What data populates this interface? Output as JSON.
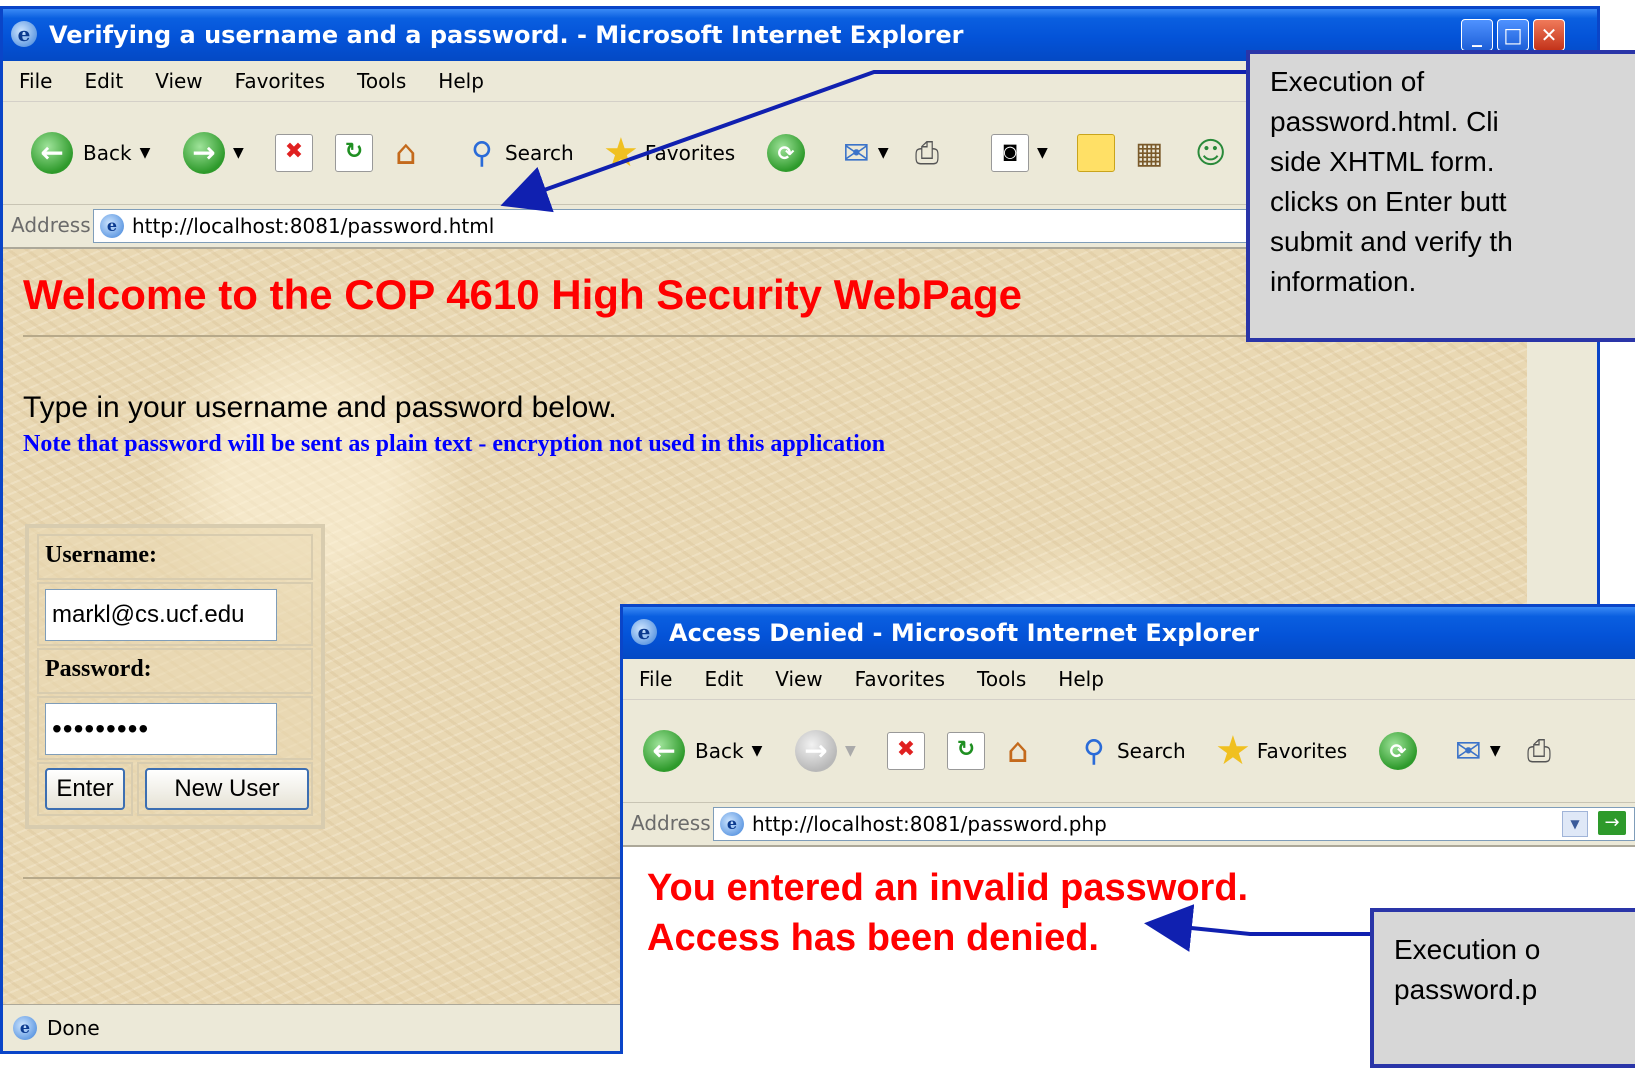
{
  "back_window": {
    "title": "Verifying a username and a password. - Microsoft Internet Explorer",
    "menu": [
      "File",
      "Edit",
      "View",
      "Favorites",
      "Tools",
      "Help"
    ],
    "toolbar": {
      "back_label": "Back",
      "search_label": "Search",
      "favorites_label": "Favorites"
    },
    "address_label": "Address",
    "url": "http://localhost:8081/password.html",
    "heading": "Welcome to the COP 4610 High Security WebPage",
    "prompt": "Type in your username and password below.",
    "note": "Note that password will be sent as plain text - encryption not used in this application",
    "form": {
      "username_label": "Username:",
      "username_value": "markl@cs.ucf.edu",
      "password_label": "Password:",
      "password_value": "•••••••••",
      "enter_label": "Enter",
      "new_user_label": "New User"
    },
    "status": "Done"
  },
  "front_window": {
    "title": "Access Denied - Microsoft Internet Explorer",
    "menu": [
      "File",
      "Edit",
      "View",
      "Favorites",
      "Tools",
      "Help"
    ],
    "toolbar": {
      "back_label": "Back",
      "search_label": "Search",
      "favorites_label": "Favorites"
    },
    "address_label": "Address",
    "url": "http://localhost:8081/password.php",
    "message_line1": "You entered an invalid password.",
    "message_line2": "Access has been denied."
  },
  "callout_top": {
    "lines": [
      "Execution of",
      "password.html.  Cli",
      "side XHTML form.",
      "clicks on Enter butt",
      "submit and verify th",
      "information."
    ]
  },
  "callout_bottom": {
    "lines": [
      "Execution o",
      "password.p"
    ]
  },
  "colors": {
    "heading": "#ff0000",
    "note": "#0000ff",
    "callout_border": "#2a35a8",
    "title_blue": "#0453d8"
  }
}
